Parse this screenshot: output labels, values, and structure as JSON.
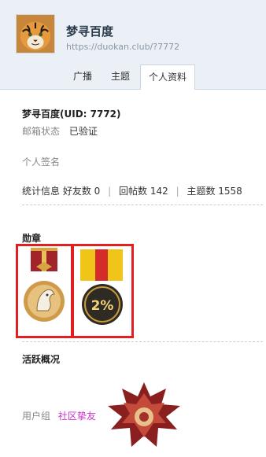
{
  "profile": {
    "username": "梦寻百度",
    "url": "https://duokan.club/?7772",
    "avatar_icon": "tiger-avatar"
  },
  "tabs": [
    {
      "label": "广播"
    },
    {
      "label": "主题"
    },
    {
      "label": "个人资料"
    }
  ],
  "info": {
    "name_uid": "梦寻百度(UID: 7772)",
    "email_label": "邮箱状态",
    "email_value": "已验证",
    "signature_label": "个人签名",
    "stats_label": "统计信息",
    "friends": "好友数 0",
    "replies": "回帖数 142",
    "threads": "主题数 1558"
  },
  "medals": {
    "heading": "勋章",
    "items": [
      {
        "icon": "horse-medal-icon"
      },
      {
        "icon": "twenty-percent-medal-icon"
      }
    ],
    "highlight_color": "#e02020"
  },
  "activity": {
    "heading": "活跃概况",
    "group_label": "用户组",
    "group_value": "社区挚友",
    "badge_icon": "rank-emblem-icon"
  },
  "colors": {
    "header_bg": "#eaf0f6",
    "link": "#cc33cc"
  }
}
